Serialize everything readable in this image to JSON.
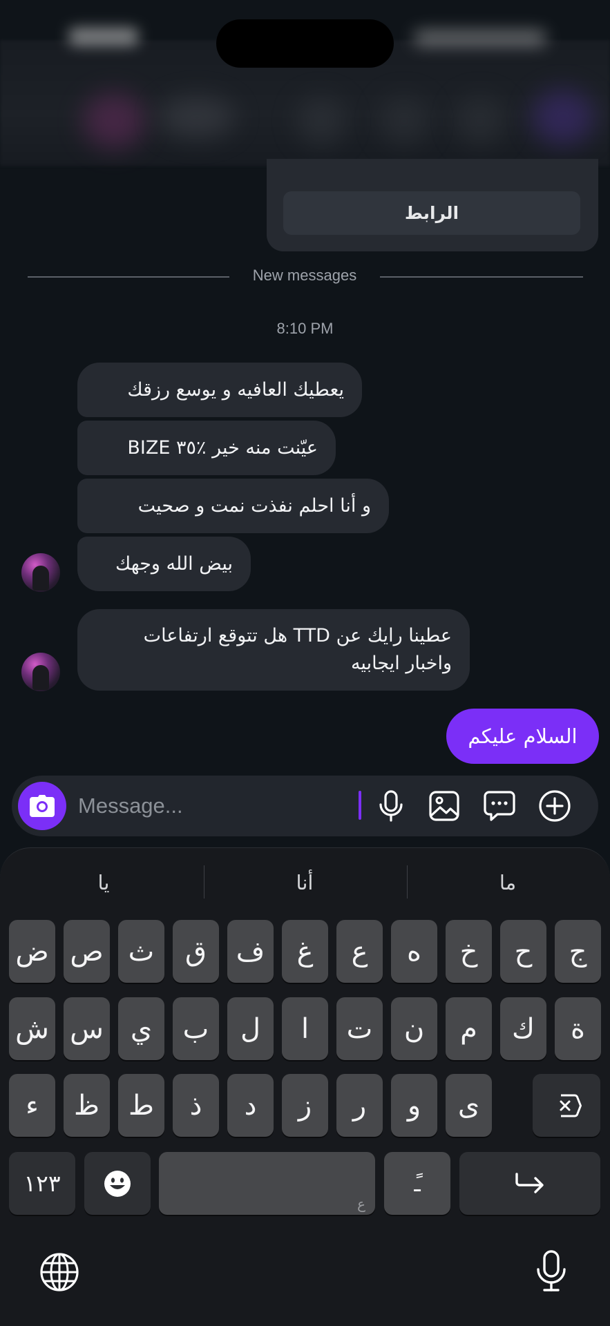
{
  "link_card": {
    "button_label": "الرابط"
  },
  "divider": {
    "label": "New messages"
  },
  "timestamp": "8:10 PM",
  "messages_in": [
    "يعطيك العافيه و يوسع رزقك",
    "عيّنت منه خير ٪٣٥ BIZE",
    "و أنا احلم نفذت نمت و صحيت",
    "بيض الله وجهك"
  ],
  "message_multi": {
    "line1": "عطينا رايك عن TTD هل تتوقع ارتفاعات",
    "line2": "واخبار ايجابيه"
  },
  "message_out": "السلام عليكم",
  "composer": {
    "placeholder": "Message...",
    "icons": [
      "camera-icon",
      "microphone-icon",
      "image-icon",
      "sticker-chat-icon",
      "plus-icon"
    ],
    "accent": "#7B2FF7"
  },
  "keyboard": {
    "suggestions": [
      "يا",
      "أنا",
      "ما"
    ],
    "row1": [
      "ض",
      "ص",
      "ث",
      "ق",
      "ف",
      "غ",
      "ع",
      "ه",
      "خ",
      "ح",
      "ج"
    ],
    "row2": [
      "ش",
      "س",
      "ي",
      "ب",
      "ل",
      "ا",
      "ت",
      "ن",
      "م",
      "ك",
      "ة"
    ],
    "row3": [
      "ء",
      "ظ",
      "ط",
      "ذ",
      "د",
      "ز",
      "ر",
      "و",
      "ى"
    ],
    "numbers_label": "١٢٣",
    "space_sublabel": "ع",
    "diacritic_label": "ًـ"
  }
}
